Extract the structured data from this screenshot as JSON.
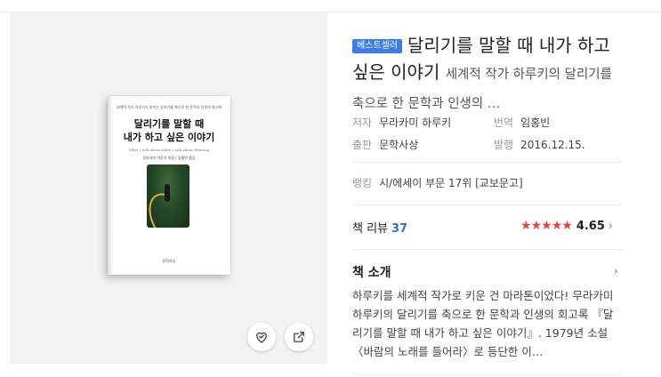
{
  "book": {
    "badge": "베스트셀러",
    "title": "달리기를 말할 때 내가 하고 싶은 이야기",
    "subtitle": "세계적 작가 하루키의 달리기를 축으로 한 문학과 인생의 …",
    "cover": {
      "tagline": "세계적 작가 하루키가 밝히는 달리기를 축으로 한 문학과 인생의 회고록",
      "title_line1": "달리기를 말할 때",
      "title_line2": "내가 하고 싶은 이야기",
      "english_title": "What I talk about when I talk about Running",
      "author_line": "무라카미 하루키 지음 | 임홍빈 옮김",
      "publisher": "문학사상"
    }
  },
  "meta": {
    "author_label": "저자",
    "author": "무라카미 하루키",
    "translator_label": "번역",
    "translator": "임홍빈",
    "publisher_label": "출판",
    "publisher": "문학사상",
    "date_label": "발행",
    "date": "2016.12.15.",
    "rank_label": "랭킹",
    "rank": "시/에세이 부문 17위 [교보문고]"
  },
  "reviews": {
    "label": "책 리뷰",
    "count": "37",
    "score": "4.65",
    "rating": 4.65
  },
  "intro": {
    "title": "책 소개",
    "body": "하루키를 세계적 작가로 키운 건 마라톤이었다! 무라카미 하루키의 달리기를 축으로 한 문학과 인생의 회고록 『달리기를 말할 때 내가 하고 싶은 이야기』. 1979년 소설 〈바람의 노래를 들어라〉로 등단한 이…"
  },
  "actions": {
    "wish_icon": "heart-check-icon",
    "share_icon": "share-icon"
  },
  "colors": {
    "accent": "#3d7de2",
    "link": "#2f6fd6",
    "star": "#e0453f"
  }
}
